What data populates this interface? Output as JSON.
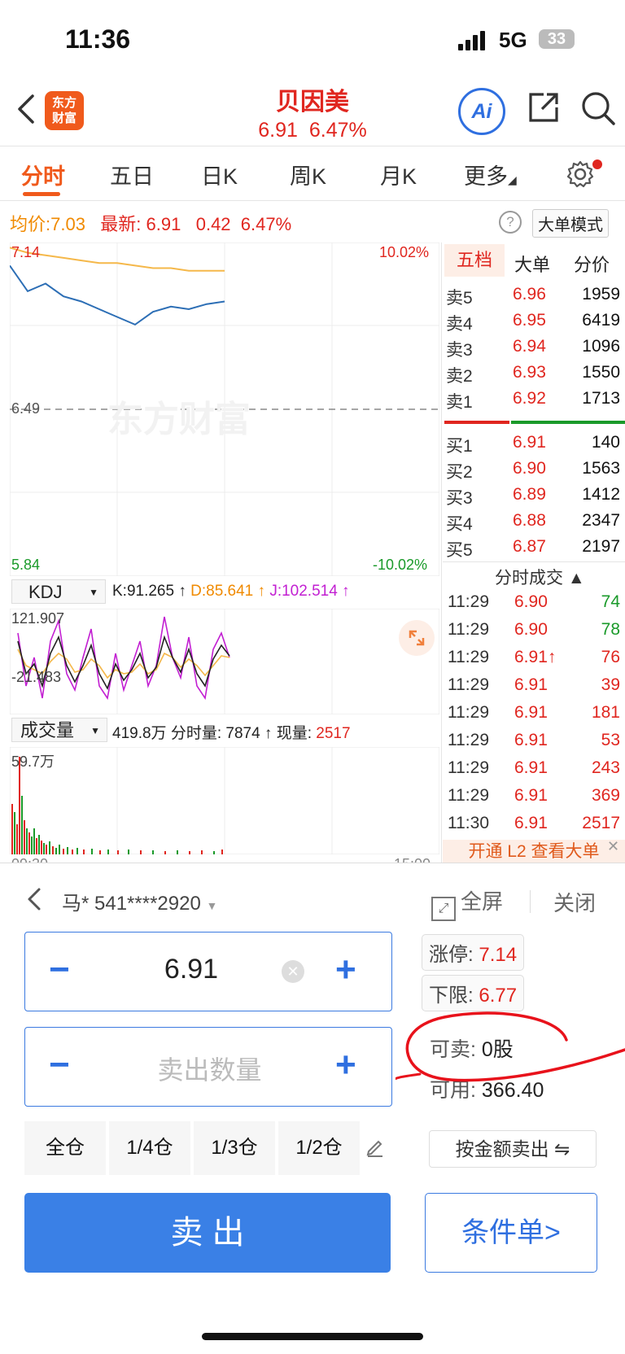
{
  "status": {
    "time": "11:36",
    "network": "5G",
    "battery": "33"
  },
  "header": {
    "logo_line1": "东方",
    "logo_line2": "财富",
    "stock_name": "贝因美",
    "price": "6.91",
    "change_pct": "6.47%",
    "ai_label": "Ai"
  },
  "tabs": [
    "分时",
    "五日",
    "日K",
    "周K",
    "月K",
    "更多"
  ],
  "info": {
    "avg_label": "均价:",
    "avg_value": "7.03",
    "latest_label": "最新:",
    "latest_value": "6.91",
    "change": "0.42",
    "change_pct": "6.47%",
    "help": "?",
    "mode_button": "大单模式"
  },
  "chart": {
    "price_high": "7.14",
    "price_mid": "6.49",
    "price_low": "5.84",
    "pct_high": "10.02%",
    "pct_low": "-10.02%",
    "watermark": "东方财富",
    "kdj_selector": "KDJ",
    "kdj_k": "K:91.265 ↑",
    "kdj_d": "D:85.641 ↑",
    "kdj_j": "J:102.514 ↑",
    "kdj_max": "121.907",
    "kdj_min": "-21.483",
    "volume_selector": "成交量",
    "volume_total": "419.8万",
    "volume_minute": "分时量: 7874 ↑",
    "volume_now_label": "现量:",
    "volume_now": "2517",
    "volume_max": "59.7万",
    "time_start": "09:30",
    "time_end": "15:00"
  },
  "chart_data": {
    "type": "line",
    "title": "",
    "xlabel": "",
    "ylabel": "",
    "ylim": [
      5.84,
      7.14
    ],
    "x": [
      "09:30",
      "09:40",
      "09:50",
      "10:00",
      "10:10",
      "10:20",
      "10:30",
      "10:40",
      "10:50",
      "11:00",
      "11:10",
      "11:20",
      "11:30"
    ],
    "series": [
      {
        "name": "",
        "values": [
          7.05,
          6.95,
          6.98,
          6.93,
          6.91,
          6.88,
          6.85,
          6.82,
          6.87,
          6.89,
          6.88,
          6.9,
          6.91
        ]
      },
      {
        "name": "",
        "values": [
          7.12,
          7.1,
          7.09,
          7.08,
          7.07,
          7.06,
          7.06,
          7.05,
          7.04,
          7.04,
          7.03,
          7.03,
          7.03
        ]
      }
    ]
  },
  "orderbook": {
    "tabs": [
      "五档",
      "大单",
      "分价"
    ],
    "sells": [
      {
        "label": "卖5",
        "price": "6.96",
        "volume": "1959"
      },
      {
        "label": "卖4",
        "price": "6.95",
        "volume": "6419"
      },
      {
        "label": "卖3",
        "price": "6.94",
        "volume": "1096"
      },
      {
        "label": "卖2",
        "price": "6.93",
        "volume": "1550"
      },
      {
        "label": "卖1",
        "price": "6.92",
        "volume": "1713"
      }
    ],
    "buys": [
      {
        "label": "买1",
        "price": "6.91",
        "volume": "140"
      },
      {
        "label": "买2",
        "price": "6.90",
        "volume": "1563"
      },
      {
        "label": "买3",
        "price": "6.89",
        "volume": "1412"
      },
      {
        "label": "买4",
        "price": "6.88",
        "volume": "2347"
      },
      {
        "label": "买5",
        "price": "6.87",
        "volume": "2197"
      }
    ],
    "trades_title": "分时成交 ▲",
    "trades": [
      {
        "time": "11:29",
        "price": "6.90",
        "volume": "74",
        "color": "#1a9a2a"
      },
      {
        "time": "11:29",
        "price": "6.90",
        "volume": "78",
        "color": "#1a9a2a"
      },
      {
        "time": "11:29",
        "price": "6.91↑",
        "volume": "76",
        "color": "#e0261f"
      },
      {
        "time": "11:29",
        "price": "6.91",
        "volume": "39",
        "color": "#e0261f"
      },
      {
        "time": "11:29",
        "price": "6.91",
        "volume": "181",
        "color": "#e0261f"
      },
      {
        "time": "11:29",
        "price": "6.91",
        "volume": "53",
        "color": "#e0261f"
      },
      {
        "time": "11:29",
        "price": "6.91",
        "volume": "243",
        "color": "#e0261f"
      },
      {
        "time": "11:29",
        "price": "6.91",
        "volume": "369",
        "color": "#e0261f"
      },
      {
        "time": "11:30",
        "price": "6.91",
        "volume": "2517",
        "color": "#e0261f"
      }
    ],
    "l2_banner": "开通 L2 查看大单"
  },
  "panel": {
    "account": "马* 541****2920",
    "fullscreen": "全屏",
    "close": "关闭",
    "price_value": "6.91",
    "qty_placeholder": "卖出数量",
    "limit_up_label": "涨停:",
    "limit_up_value": "7.14",
    "limit_down_label": "下限:",
    "limit_down_value": "6.77",
    "sellable_label": "可卖:",
    "sellable_value": "0股",
    "available_label": "可用:",
    "available_value": "366.40",
    "positions": [
      "全仓",
      "1/4仓",
      "1/3仓",
      "1/2仓"
    ],
    "amount_sell": "按金额卖出 ⇋",
    "sell_button": "卖 出",
    "condition_button": "条件单>"
  }
}
